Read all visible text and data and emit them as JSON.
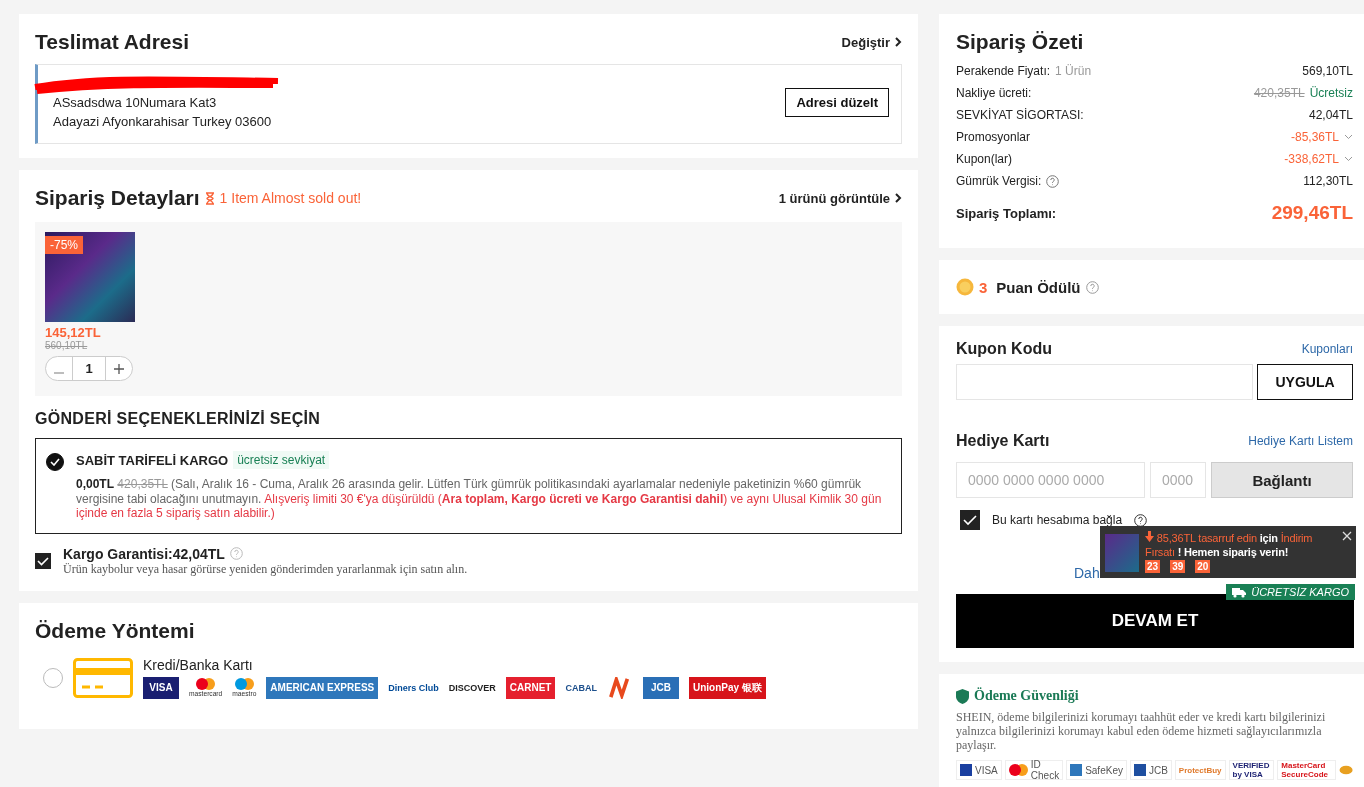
{
  "address": {
    "title": "Teslimat Adresi",
    "change_link": "Değiştir",
    "lines": [
      "ASsadsdwa 10Numara Kat3",
      "Adayazi Afyonkarahisar Turkey 03600"
    ],
    "edit_button": "Adresi düzelt"
  },
  "order_details": {
    "title": "Sipariş Detayları",
    "stock_warning": "1 Item Almost sold out!",
    "view_link": "1 ürünü görüntüle",
    "items": [
      {
        "discount_badge": "-75%",
        "price": "145,12TL",
        "original_price": "560,10TL",
        "quantity": "1"
      }
    ]
  },
  "shipping": {
    "title": "GÖNDERİ SEÇENEKLERİNİZİ SEÇİN",
    "options": [
      {
        "name": "SABİT TARİFELİ KARGO",
        "tag": "ücretsiz sevkiyat",
        "selected": true,
        "price": "0,00TL",
        "old_price": "420,35TL",
        "note": "(Salı, Aralık 16 - Cuma, Aralık 26 arasında gelir. Lütfen Türk gümrük politikasındaki ayarlamalar nedeniyle paketinizin %60 gümrük vergisine tabi olacağını unutmayın.",
        "warning": "Alışveriş limiti 30 €'ya düşürüldü (**Ara toplam, Kargo ücreti ve Kargo Garantisi dahil**) ve aynı Ulusal Kimlik 30 gün içinde en fazla 5 sipariş satın alabilir.)"
      }
    ],
    "guarantee": {
      "label": "Kargo Garantisi:42,04TL",
      "checked": true,
      "description": "Ürün kaybolur veya hasar görürse yeniden gönderimden yararlanmak için satın alın."
    }
  },
  "payment": {
    "title": "Ödeme Yöntemi",
    "methods": [
      {
        "label": "Kredi/Banka Kartı",
        "selected": false,
        "logos": [
          {
            "kind": "badge",
            "text": "VISA",
            "color": "#1a1f71"
          },
          {
            "kind": "circles",
            "text": "mastercard",
            "color": "#eb001b"
          },
          {
            "kind": "circles",
            "text": "maestro",
            "color": "#0099df"
          },
          {
            "kind": "badge",
            "text": "AMERICAN EXPRESS",
            "color": "#2e77bb"
          },
          {
            "kind": "word",
            "text": "Diners Club",
            "color": "#004a97"
          },
          {
            "kind": "word",
            "text": "DISCOVER",
            "color": "#222222"
          },
          {
            "kind": "badge",
            "text": "CARNET",
            "color": "#e5202e"
          },
          {
            "kind": "word",
            "text": "CABAL",
            "color": "#1c4f8c"
          },
          {
            "kind": "mark",
            "color": "#e8491d"
          },
          {
            "kind": "badge",
            "text": "JCB",
            "color": "#2a6fb6"
          },
          {
            "kind": "badge",
            "text": "UnionPay 银联",
            "color": "#d7141a"
          }
        ]
      }
    ]
  },
  "summary": {
    "title": "Sipariş Özeti",
    "rows": [
      {
        "kind": "plain",
        "label": "Perakende Fiyatı:",
        "label_note": "1 Ürün",
        "value": "569,10TL"
      },
      {
        "kind": "free",
        "label": "Nakliye ücreti:",
        "old_value": "420,35TL",
        "value": "Ücretsiz"
      },
      {
        "kind": "plain",
        "label": "SEVKİYAT SİGORTASI:",
        "value": "42,04TL"
      },
      {
        "kind": "discount",
        "label": "Promosyonlar",
        "value": "-85,36TL"
      },
      {
        "kind": "discount",
        "label": "Kupon(lar)",
        "value": "-338,62TL"
      },
      {
        "kind": "plain",
        "label": "Gümrük Vergisi:",
        "help": true,
        "value": "112,30TL"
      }
    ],
    "total_label": "Sipariş Toplamı:",
    "total_value": "299,46TL"
  },
  "points": {
    "count": "3",
    "label": "Puan Ödülü"
  },
  "coupon": {
    "title": "Kupon Kodu",
    "link": "Kuponları",
    "button": "UYGULA"
  },
  "gift_card": {
    "title": "Hediye Kartı",
    "link": "Hediye Kartı Listem",
    "number_placeholder": "0000 0000 0000 0000",
    "pin_placeholder": "0000",
    "button": "Bağlantı",
    "bind_label": "Bu kartı hesabıma bağla",
    "bind_checked": true,
    "more_link": "Dah"
  },
  "promo_popup": {
    "parts": [
      {
        "text": "85,36TL tasarruf edin",
        "highlight": true
      },
      {
        "text": "için",
        "highlight": false
      },
      {
        "text": "İndirim Fırsatı",
        "highlight": true
      },
      {
        "text": "! Hemen sipariş verin!",
        "highlight": false
      }
    ],
    "countdown": [
      "23",
      "39",
      "20"
    ]
  },
  "checkout": {
    "button": "DEVAM ET",
    "badge": "ÜCRETSİZ KARGO"
  },
  "security": {
    "title": "Ödeme Güvenliği",
    "text": "SHEIN, ödeme bilgilerinizi korumayı taahhüt eder ve kredi kartı bilgilerinizi yalnızca bilgilerinizi korumayı kabul eden ödeme hizmeti sağlayıcılarımızla paylaşır.",
    "badges": [
      {
        "kind": "block",
        "text": "VISA",
        "color": "#1a3fa0"
      },
      {
        "kind": "circles",
        "text": "ID Check",
        "color": "#eb001b"
      },
      {
        "kind": "block",
        "text": "SafeKey",
        "color": "#2e77bb"
      },
      {
        "kind": "block",
        "text": "JCB",
        "color": "#1f4fa0"
      },
      {
        "kind": "word",
        "text": "ProtectBuy",
        "color": "#e07a2c"
      },
      {
        "kind": "word",
        "text": "VERIFIED by VISA",
        "color": "#1a1f71"
      },
      {
        "kind": "word",
        "text": "MasterCard SecureCode",
        "color": "#d7141a"
      },
      {
        "kind": "mark",
        "color": "#e8a020"
      }
    ]
  }
}
